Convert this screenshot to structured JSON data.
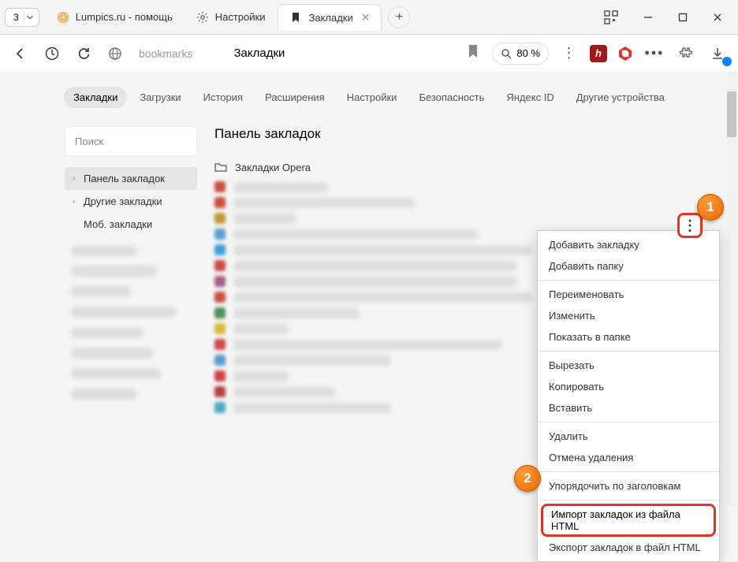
{
  "titlebar": {
    "tab_count": "3",
    "tabs": [
      {
        "label": "Lumpics.ru - помощь"
      },
      {
        "label": "Настройки"
      },
      {
        "label": "Закладки"
      }
    ]
  },
  "addressbar": {
    "url_text": "bookmarks",
    "page_title": "Закладки",
    "zoom": "80 %"
  },
  "topnav": {
    "items": [
      "Закладки",
      "Загрузки",
      "История",
      "Расширения",
      "Настройки",
      "Безопасность",
      "Яндекс ID",
      "Другие устройства"
    ]
  },
  "sidebar": {
    "search_placeholder": "Поиск",
    "items": [
      {
        "label": "Панель закладок"
      },
      {
        "label": "Другие закладки"
      },
      {
        "label": "Моб. закладки"
      }
    ]
  },
  "main": {
    "heading": "Панель закладок",
    "folder": "Закладки Opera"
  },
  "context_menu": {
    "groups": [
      [
        "Добавить закладку",
        "Добавить папку"
      ],
      [
        "Переименовать",
        "Изменить",
        "Показать в папке"
      ],
      [
        "Вырезать",
        "Копировать",
        "Вставить"
      ],
      [
        "Удалить",
        "Отмена удаления"
      ],
      [
        "Упорядочить по заголовкам"
      ]
    ],
    "highlighted": "Импорт закладок из файла HTML",
    "after_highlight": "Экспорт закладок в файл HTML"
  },
  "callouts": {
    "c1": "1",
    "c2": "2"
  }
}
